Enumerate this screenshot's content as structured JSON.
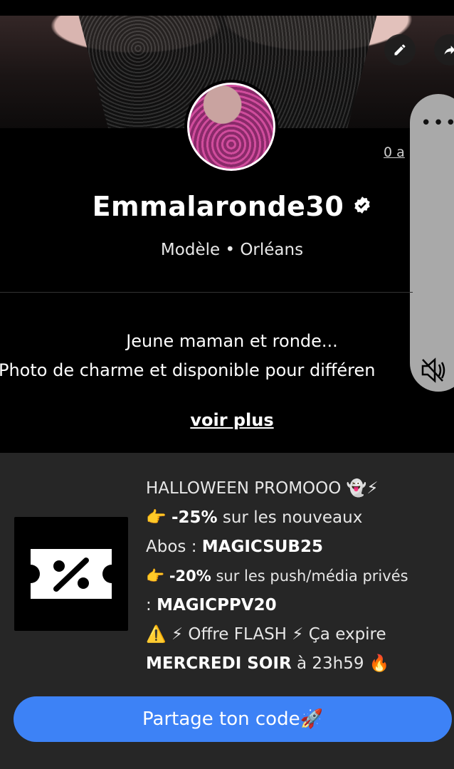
{
  "profile": {
    "name": "Emmalaronde30",
    "subtitle": "Modèle • Orléans",
    "count_link": "0 a",
    "bio_line1": "Jeune maman et ronde...",
    "bio_line2": "Photo de charme et disponible pour différen",
    "see_more": "voir plus"
  },
  "promo": {
    "line1": "HALLOWEEN PROMOOO 👻⚡",
    "line2_prefix": "👉 ",
    "line2_bold": "-25%",
    "line2_rest": " sur les nouveaux",
    "line3_prefix": "Abos : ",
    "line3_code": "MAGICSUB25",
    "line4_prefix": "👉 ",
    "line4_bold": "-20%",
    "line4_rest": " sur les push/média privés",
    "line5_prefix": ": ",
    "line5_code": "MAGICPPV20",
    "line6": "⚠️ ⚡ Offre FLASH ⚡ Ça expire",
    "line7_bold": "MERCREDI SOIR",
    "line7_rest": " à 23h59 🔥",
    "share_button": "Partage ton code🚀"
  },
  "icons": {
    "edit": "pencil-icon",
    "share": "share-arrow-icon",
    "verified": "verified-badge-icon",
    "menu": "more-dots-icon",
    "mute": "speaker-muted-icon",
    "coupon": "percent-ticket-icon"
  },
  "colors": {
    "accent": "#3d82f6",
    "background": "#000000",
    "promo_background": "#262626"
  }
}
